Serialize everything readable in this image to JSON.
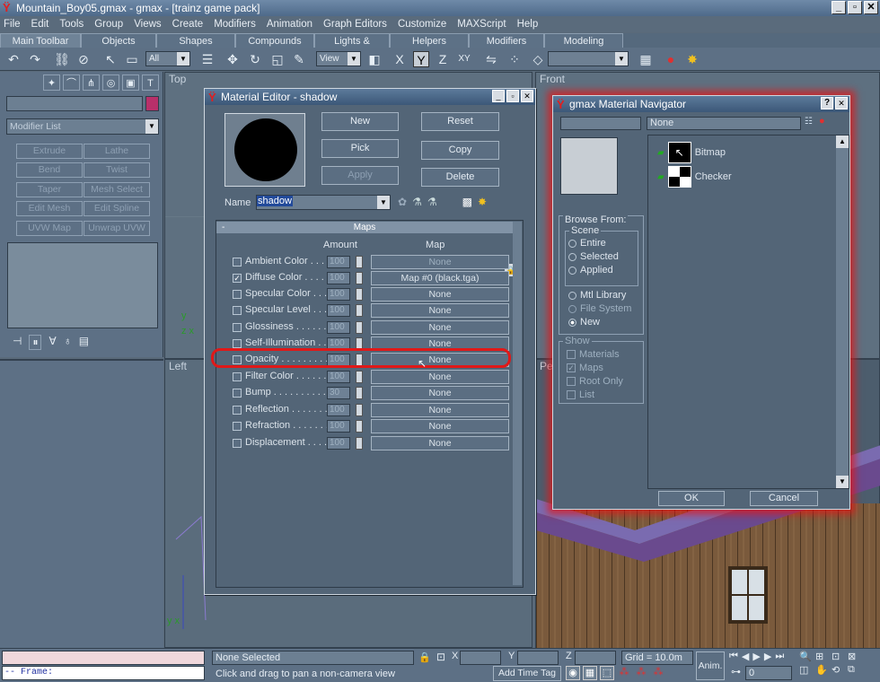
{
  "app": {
    "title": "Mountain_Boy05.gmax - gmax - [trainz game pack]"
  },
  "menu": [
    "File",
    "Edit",
    "Tools",
    "Group",
    "Views",
    "Create",
    "Modifiers",
    "Animation",
    "Graph Editors",
    "Customize",
    "MAXScript",
    "Help"
  ],
  "tabs": [
    "Main Toolbar",
    "Objects",
    "Shapes",
    "Compounds",
    "Lights & Cameras",
    "Helpers",
    "Modifiers",
    "Modeling"
  ],
  "toolbar": {
    "filter": "All",
    "refcoord": "View"
  },
  "cmdpanel": {
    "modifier_list": "Modifier List",
    "buttons": [
      "Extrude",
      "Lathe",
      "Bend",
      "Twist",
      "Taper",
      "Mesh Select",
      "Edit Mesh",
      "Edit Spline",
      "UVW Map",
      "Unwrap UVW"
    ]
  },
  "viewports": {
    "top": "Top",
    "front": "Front",
    "left": "Left",
    "persp": "Persp"
  },
  "mat_editor": {
    "title": "Material Editor - shadow",
    "buttons": {
      "new": "New",
      "reset": "Reset",
      "pick": "Pick",
      "copy": "Copy",
      "apply": "Apply",
      "delete": "Delete"
    },
    "name_label": "Name",
    "name_value": "shadow",
    "maps_title": "Maps",
    "amount_header": "Amount",
    "map_header": "Map",
    "rows": [
      {
        "label": "Ambient Color . . . . . .",
        "amount": "100",
        "map": "None",
        "checked": false
      },
      {
        "label": "Diffuse Color . . . . . .",
        "amount": "100",
        "map": "Map #0 (black.tga)",
        "checked": true
      },
      {
        "label": "Specular Color . . . . .",
        "amount": "100",
        "map": "None",
        "checked": false
      },
      {
        "label": "Specular Level . . . . .",
        "amount": "100",
        "map": "None",
        "checked": false
      },
      {
        "label": "Glossiness . . . . . . .",
        "amount": "100",
        "map": "None",
        "checked": false
      },
      {
        "label": "Self-Illumination . . . .",
        "amount": "100",
        "map": "None",
        "checked": false
      },
      {
        "label": "Opacity . . . . . . . . . .",
        "amount": "100",
        "map": "None",
        "checked": false
      },
      {
        "label": "Filter Color . . . . . . .",
        "amount": "100",
        "map": "None",
        "checked": false
      },
      {
        "label": "Bump . . . . . . . . . . .",
        "amount": "30",
        "map": "None",
        "checked": false
      },
      {
        "label": "Reflection . . . . . . . .",
        "amount": "100",
        "map": "None",
        "checked": false
      },
      {
        "label": "Refraction . . . . . . . .",
        "amount": "100",
        "map": "None",
        "checked": false
      },
      {
        "label": "Displacement . . . . .",
        "amount": "100",
        "map": "None",
        "checked": false
      }
    ]
  },
  "navigator": {
    "title": "gmax Material Navigator",
    "field": "None",
    "items": [
      "Bitmap",
      "Checker"
    ],
    "browse_from": "Browse From:",
    "scene_group": "Scene",
    "scene_opts": [
      "Entire",
      "Selected",
      "Applied"
    ],
    "more_opts": [
      "Mtl Library",
      "File System",
      "New"
    ],
    "show_group": "Show",
    "show_opts": [
      "Materials",
      "Maps",
      "Root Only",
      "List"
    ],
    "ok": "OK",
    "cancel": "Cancel"
  },
  "status": {
    "frame_label": "-- Frame:",
    "selected": "None Selected",
    "prompt": "Click and drag to pan a non-camera view",
    "x": "X",
    "y": "Y",
    "z": "Z",
    "grid": "Grid = 10.0m",
    "anim": "Anim.",
    "add_time_tag": "Add Time Tag",
    "frame_value": "0"
  }
}
